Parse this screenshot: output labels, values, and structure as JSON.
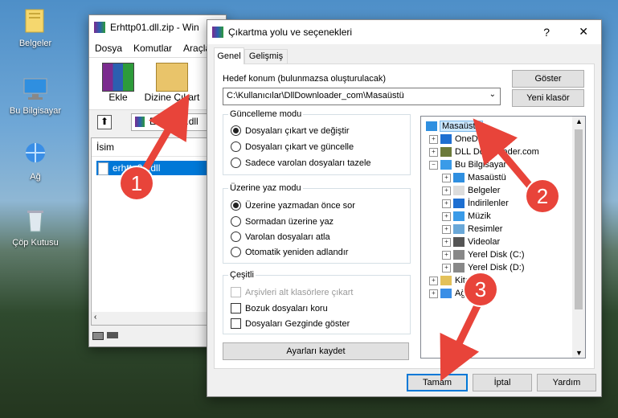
{
  "desktop": {
    "icons": [
      {
        "label": "Belgeler",
        "icon": "folder-icon"
      },
      {
        "label": "Bu Bilgisayar",
        "icon": "computer-icon"
      },
      {
        "label": "Ağ",
        "icon": "network-icon"
      },
      {
        "label": "Çöp Kutusu",
        "icon": "recycle-bin-icon"
      }
    ]
  },
  "winrar": {
    "title": "Erhttp01.dll.zip - Win",
    "menu": [
      "Dosya",
      "Komutlar",
      "Araçla"
    ],
    "toolbar": {
      "add": "Ekle",
      "extract": "Dizine Çıkart"
    },
    "path": "Erhttp01.dll",
    "column_name": "İsim",
    "file_row": "erhttp01.dll"
  },
  "dialog": {
    "title": "Çıkartma yolu ve seçenekleri",
    "help_glyph": "?",
    "close_glyph": "✕",
    "tabs": [
      "Genel",
      "Gelişmiş"
    ],
    "dest_label": "Hedef konum (bulunmazsa oluşturulacak)",
    "dest_value": "C:\\Kullanıcılar\\DllDownloader_com\\Masaüstü",
    "show_button": "Göster",
    "new_folder_button": "Yeni klasör",
    "update_group": {
      "title": "Güncelleme modu",
      "options": [
        "Dosyaları çıkart ve değiştir",
        "Dosyaları çıkart ve güncelle",
        "Sadece varolan dosyaları tazele"
      ],
      "selected": 0
    },
    "overwrite_group": {
      "title": "Üzerine yaz modu",
      "options": [
        "Üzerine yazmadan önce sor",
        "Sormadan üzerine yaz",
        "Varolan dosyaları atla",
        "Otomatik yeniden adlandır"
      ],
      "selected": 0
    },
    "misc_group": {
      "title": "Çeşitli",
      "options": [
        "Arşivleri alt klasörlere çıkart",
        "Bozuk dosyaları koru",
        "Dosyaları Gezginde göster"
      ]
    },
    "save_settings_button": "Ayarları kaydet",
    "tree": [
      {
        "label": "Masaüstü",
        "icon": "desktop-icon",
        "level": 0,
        "selected": true
      },
      {
        "label": "OneDrive",
        "icon": "cloud-icon",
        "level": 1,
        "exp": "+"
      },
      {
        "label": "DLL Downloader.com",
        "icon": "user-icon",
        "level": 1,
        "exp": "+"
      },
      {
        "label": "Bu Bilgisayar",
        "icon": "computer-icon",
        "level": 1,
        "exp": "−"
      },
      {
        "label": "Masaüstü",
        "icon": "desktop-icon",
        "level": 2,
        "exp": "+"
      },
      {
        "label": "Belgeler",
        "icon": "documents-icon",
        "level": 2,
        "exp": "+"
      },
      {
        "label": "İndirilenler",
        "icon": "download-icon",
        "level": 2,
        "exp": "+"
      },
      {
        "label": "Müzik",
        "icon": "music-icon",
        "level": 2,
        "exp": "+"
      },
      {
        "label": "Resimler",
        "icon": "pictures-icon",
        "level": 2,
        "exp": "+"
      },
      {
        "label": "Videolar",
        "icon": "videos-icon",
        "level": 2,
        "exp": "+"
      },
      {
        "label": "Yerel Disk (C:)",
        "icon": "disk-icon",
        "level": 2,
        "exp": "+"
      },
      {
        "label": "Yerel Disk (D:)",
        "icon": "disk-icon",
        "level": 2,
        "exp": "+"
      },
      {
        "label": "Kitap",
        "icon": "library-icon",
        "level": 1,
        "exp": "+"
      },
      {
        "label": "Ağ",
        "icon": "network-icon",
        "level": 1,
        "exp": "+"
      }
    ],
    "ok_button": "Tamam",
    "cancel_button": "İptal",
    "help_button": "Yardım"
  },
  "annotations": [
    "1",
    "2",
    "3"
  ],
  "colors": {
    "arrow": "#e8443a",
    "selection": "#0078d7",
    "tree_selected": "#cce8ff"
  }
}
